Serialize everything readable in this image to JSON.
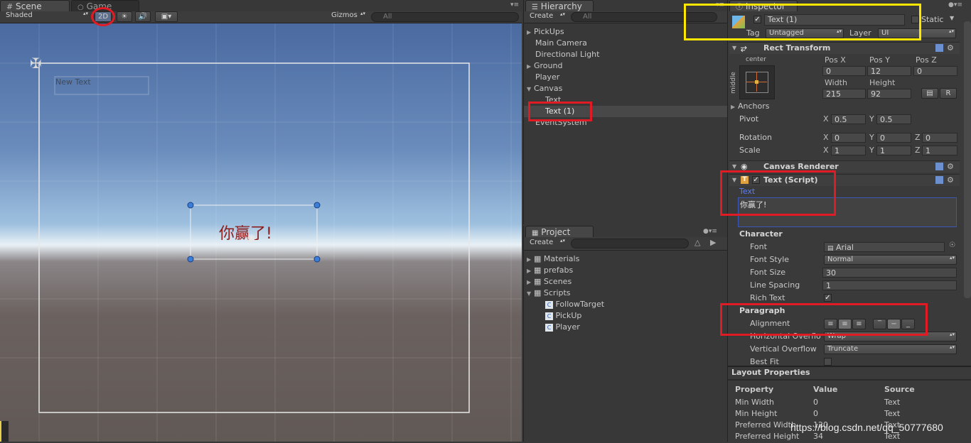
{
  "scene": {
    "tabs": {
      "scene": "Scene",
      "game": "Game"
    },
    "toolbar": {
      "shading": "Shaded",
      "mode2d": "2D",
      "gizmos": "Gizmos",
      "search_placeholder": "All"
    },
    "canvas_text": "New Text",
    "win_text": "你赢了!"
  },
  "hierarchy": {
    "tab": "Hierarchy",
    "create": "Create",
    "search_placeholder": "All",
    "items": [
      "PickUps",
      "Main Camera",
      "Directional Light",
      "Ground",
      "Player",
      "Canvas",
      "Text",
      "Text (1)",
      "EventSystem"
    ]
  },
  "project": {
    "tab": "Project",
    "create": "Create",
    "folders": [
      "Materials",
      "prefabs",
      "Scenes",
      "Scripts"
    ],
    "scripts": [
      "FollowTarget",
      "PickUp",
      "Player"
    ]
  },
  "inspector": {
    "tab": "Inspector",
    "object_name": "Text (1)",
    "static_label": "Static",
    "tag_label": "Tag",
    "tag_value": "Untagged",
    "layer_label": "Layer",
    "layer_value": "UI",
    "rect_transform": {
      "title": "Rect Transform",
      "anchor_h": "center",
      "anchor_v": "middle",
      "pos_x_label": "Pos X",
      "pos_y_label": "Pos Y",
      "pos_z_label": "Pos Z",
      "pos_x": "0",
      "pos_y": "12",
      "pos_z": "0",
      "width_label": "Width",
      "height_label": "Height",
      "width": "215",
      "height": "92",
      "r_button": "R",
      "anchors": "Anchors",
      "pivot": "Pivot",
      "pivot_x": "0.5",
      "pivot_y": "0.5",
      "rotation": "Rotation",
      "rot_x": "0",
      "rot_y": "0",
      "rot_z": "0",
      "scale": "Scale",
      "scale_x": "1",
      "scale_y": "1",
      "scale_z": "1",
      "x": "X",
      "y": "Y",
      "z": "Z"
    },
    "canvas_renderer": {
      "title": "Canvas Renderer"
    },
    "text_script": {
      "title": "Text (Script)",
      "text_label": "Text",
      "text_value": "你赢了!",
      "character": "Character",
      "font_label": "Font",
      "font_value": "Arial",
      "font_style_label": "Font Style",
      "font_style_value": "Normal",
      "font_size_label": "Font Size",
      "font_size_value": "30",
      "line_spacing_label": "Line Spacing",
      "line_spacing_value": "1",
      "rich_text_label": "Rich Text",
      "paragraph": "Paragraph",
      "alignment_label": "Alignment",
      "h_overflow_label": "Horizontal Overflo",
      "h_overflow_value": "Wrap",
      "v_overflow_label": "Vertical Overflow",
      "v_overflow_value": "Truncate",
      "best_fit_label": "Best Fit"
    },
    "layout_properties": {
      "title": "Layout Properties",
      "headers": [
        "Property",
        "Value",
        "Source"
      ],
      "rows": [
        [
          "Min Width",
          "0",
          "Text"
        ],
        [
          "Min Height",
          "0",
          "Text"
        ],
        [
          "Preferred Width",
          "120",
          "Text"
        ],
        [
          "Preferred Height",
          "34",
          "Text"
        ]
      ]
    }
  },
  "watermark": "https://blog.csdn.net/qq_50777680",
  "colors": {
    "annotation_red": "#e01b24",
    "annotation_yellow": "#ffe600",
    "link_blue": "#5b7df0"
  }
}
